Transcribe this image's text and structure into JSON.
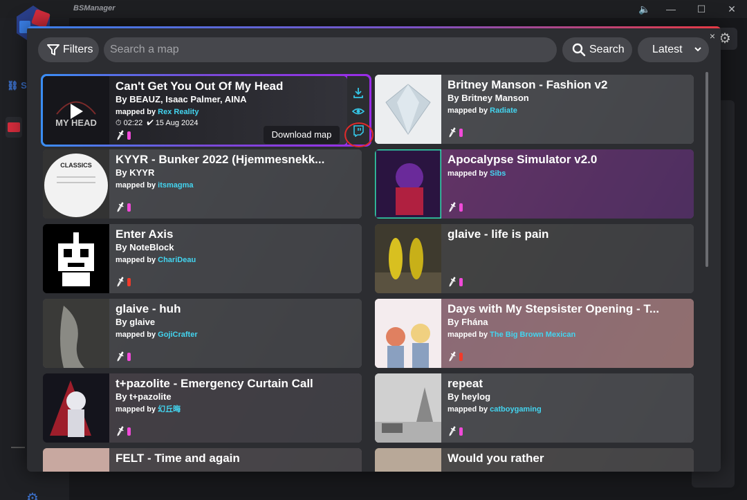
{
  "app": {
    "title": "BSManager"
  },
  "sidebar": {
    "link_label": "S"
  },
  "modal": {
    "close_glyph": "×"
  },
  "toolbar": {
    "filters_label": "Filters",
    "search_placeholder": "Search a map",
    "search_value": "",
    "search_button_label": "Search",
    "sort_selected": "Latest"
  },
  "tooltip": {
    "label": "Download map"
  },
  "maps": [
    {
      "title": "Can't Get You Out Of My Head",
      "by": "By BEAUZ, Isaac Palmer, AINA",
      "mapped_prefix": "mapped by",
      "mapper": "Rex Reality",
      "duration": "02:22",
      "date": "15 Aug 2024",
      "pills": [
        "#f04ad8"
      ],
      "cover_text": "MY HEAD"
    },
    {
      "title": "Britney Manson - Fashion v2",
      "by": "By Britney Manson",
      "mapped_prefix": "mapped by",
      "mapper": "Radiate",
      "pills": [
        "#f04ad8"
      ]
    },
    {
      "title": "KYYR - Bunker 2022 (Hjemmesnekk...",
      "by": "By KYYR",
      "mapped_prefix": "mapped by",
      "mapper": "itsmagma",
      "pills": [
        "#f04ad8"
      ],
      "cover_text": "CLASSICS"
    },
    {
      "title": "Apocalypse Simulator v2.0",
      "by": "",
      "mapped_prefix": "mapped by",
      "mapper": "Sibs",
      "pills": [
        "#f04ad8"
      ]
    },
    {
      "title": "Enter Axis",
      "by": "By NoteBlock",
      "mapped_prefix": "mapped by",
      "mapper": "ChariDeau",
      "pills": [
        "#f03a2a"
      ]
    },
    {
      "title": "glaive - life is pain",
      "by": "",
      "mapped_prefix": "",
      "mapper": "",
      "pills": [
        "#f04ad8"
      ]
    },
    {
      "title": "glaive - huh",
      "by": "By glaive",
      "mapped_prefix": "mapped by",
      "mapper": "GojiCrafter",
      "pills": [
        "#f04ad8"
      ]
    },
    {
      "title": "Days with My Stepsister Opening - T...",
      "by": "By Fhána",
      "mapped_prefix": "mapped by",
      "mapper": "The Big Brown Mexican",
      "pills": [
        "#f03a2a"
      ]
    },
    {
      "title": "t+pazolite - Emergency Curtain Call",
      "by": "By t+pazolite",
      "mapped_prefix": "mapped by",
      "mapper": "幻丘晦",
      "pills": [
        "#f04ad8"
      ]
    },
    {
      "title": "repeat",
      "by": "By heylog",
      "mapped_prefix": "mapped by",
      "mapper": "catboygaming",
      "pills": [
        "#f04ad8"
      ]
    },
    {
      "title": "FELT - Time and again",
      "by": "",
      "mapped_prefix": "",
      "mapper": "",
      "pills": []
    },
    {
      "title": "Would you rather",
      "by": "",
      "mapped_prefix": "",
      "mapper": "",
      "pills": []
    }
  ],
  "colors": {
    "accent": "#3a7fe8",
    "mapper": "#43d5f0",
    "highlight": "#e02a2a",
    "action_icon": "#35c6e6"
  }
}
